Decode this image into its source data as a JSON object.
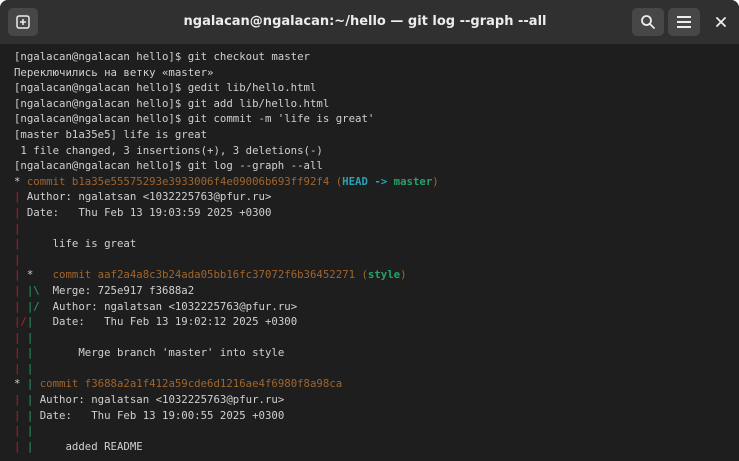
{
  "window": {
    "title": "ngalacan@ngalacan:~/hello — git log --graph --all"
  },
  "titlebar_icons": {
    "new_tab": "new-tab-icon",
    "search": "search-icon",
    "menu": "hamburger-menu-icon",
    "close": "close-icon"
  },
  "colors": {
    "background": "#1e1e1e",
    "titlebar": "#303030",
    "text": "#d0d0d0",
    "commit_hash": "#a1652c",
    "graph_red": "#c01c28",
    "graph_green": "#26a269",
    "head_blue": "#2aa1b3",
    "ref_green": "#26a269"
  },
  "terminal": {
    "lines": [
      [
        {
          "t": "[ngalacan@ngalacan hello]$ git checkout master",
          "c": "white"
        }
      ],
      [
        {
          "t": "Переключились на ветку «master»",
          "c": "white"
        }
      ],
      [
        {
          "t": "[ngalacan@ngalacan hello]$ gedit lib/hello.html",
          "c": "white"
        }
      ],
      [
        {
          "t": "[ngalacan@ngalacan hello]$ git add lib/hello.html",
          "c": "white"
        }
      ],
      [
        {
          "t": "[ngalacan@ngalacan hello]$ git commit -m 'life is great'",
          "c": "white"
        }
      ],
      [
        {
          "t": "[master b1a35e5] life is great",
          "c": "white"
        }
      ],
      [
        {
          "t": " 1 file changed, 3 insertions(+), 3 deletions(-)",
          "c": "white"
        }
      ],
      [
        {
          "t": "[ngalacan@ngalacan hello]$ git log --graph --all",
          "c": "white"
        }
      ],
      [
        {
          "t": "* ",
          "c": "white"
        },
        {
          "t": "commit b1a35e55575293e3933006f4e09006b693ff92f4 (",
          "c": "yellow"
        },
        {
          "t": "HEAD -> ",
          "c": "blue"
        },
        {
          "t": "master",
          "c": "ref"
        },
        {
          "t": ")",
          "c": "yellow"
        }
      ],
      [
        {
          "t": "| ",
          "c": "red"
        },
        {
          "t": "Author: ngalatsan <1032225763@pfur.ru>",
          "c": "white"
        }
      ],
      [
        {
          "t": "| ",
          "c": "red"
        },
        {
          "t": "Date:   Thu Feb 13 19:03:59 2025 +0300",
          "c": "white"
        }
      ],
      [
        {
          "t": "|",
          "c": "red"
        }
      ],
      [
        {
          "t": "| ",
          "c": "red"
        },
        {
          "t": "    life is great",
          "c": "white"
        }
      ],
      [
        {
          "t": "|",
          "c": "red"
        }
      ],
      [
        {
          "t": "| ",
          "c": "red"
        },
        {
          "t": "* ",
          "c": "white"
        },
        {
          "t": "  commit aaf2a4a8c3b24ada05bb16fc37072f6b36452271 (",
          "c": "yellow"
        },
        {
          "t": "style",
          "c": "ref"
        },
        {
          "t": ")",
          "c": "yellow"
        }
      ],
      [
        {
          "t": "| ",
          "c": "red"
        },
        {
          "t": "|\\",
          "c": "green"
        },
        {
          "t": "  Merge: 725e917 f3688a2",
          "c": "white"
        }
      ],
      [
        {
          "t": "| ",
          "c": "red"
        },
        {
          "t": "|/",
          "c": "green"
        },
        {
          "t": "  Author: ngalatsan <1032225763@pfur.ru>",
          "c": "white"
        }
      ],
      [
        {
          "t": "|/",
          "c": "red"
        },
        {
          "t": "|",
          "c": "green"
        },
        {
          "t": "   Date:   Thu Feb 13 19:02:12 2025 +0300",
          "c": "white"
        }
      ],
      [
        {
          "t": "| ",
          "c": "red"
        },
        {
          "t": "|",
          "c": "green"
        }
      ],
      [
        {
          "t": "| ",
          "c": "red"
        },
        {
          "t": "|",
          "c": "green"
        },
        {
          "t": "       Merge branch 'master' into style",
          "c": "white"
        }
      ],
      [
        {
          "t": "| ",
          "c": "red"
        },
        {
          "t": "|",
          "c": "green"
        }
      ],
      [
        {
          "t": "* ",
          "c": "white"
        },
        {
          "t": "| ",
          "c": "green"
        },
        {
          "t": "commit f3688a2a1f412a59cde6d1216ae4f6980f8a98ca",
          "c": "yellow"
        }
      ],
      [
        {
          "t": "| ",
          "c": "red"
        },
        {
          "t": "| ",
          "c": "green"
        },
        {
          "t": "Author: ngalatsan <1032225763@pfur.ru>",
          "c": "white"
        }
      ],
      [
        {
          "t": "| ",
          "c": "red"
        },
        {
          "t": "| ",
          "c": "green"
        },
        {
          "t": "Date:   Thu Feb 13 19:00:55 2025 +0300",
          "c": "white"
        }
      ],
      [
        {
          "t": "| ",
          "c": "red"
        },
        {
          "t": "|",
          "c": "green"
        }
      ],
      [
        {
          "t": "| ",
          "c": "red"
        },
        {
          "t": "| ",
          "c": "green"
        },
        {
          "t": "    added README",
          "c": "white"
        }
      ]
    ]
  }
}
